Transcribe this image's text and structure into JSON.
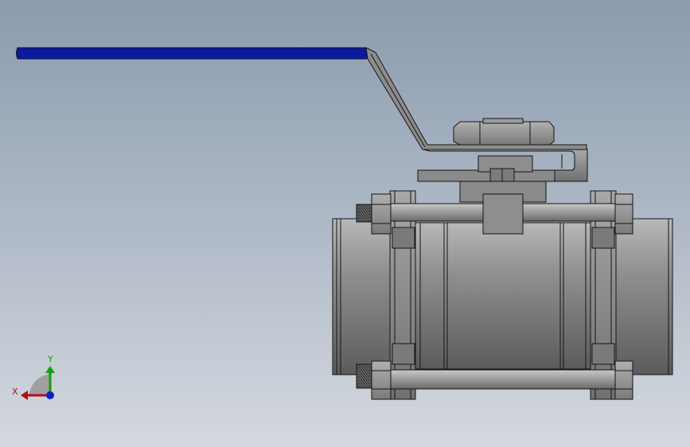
{
  "viewport": {
    "background_top": "#8a9bae",
    "background_bottom": "#d4d8df"
  },
  "model": {
    "handle_color": "#0a1aa0",
    "body_light": "#b4b4b4",
    "body_mid": "#8c8c8c",
    "body_dark": "#5a5a5a",
    "edge_color": "#141414"
  },
  "triad": {
    "x_label": "X",
    "y_label": "Y",
    "x_color": "#b01010",
    "y_color": "#10a010",
    "z_color": "#1020c0"
  }
}
